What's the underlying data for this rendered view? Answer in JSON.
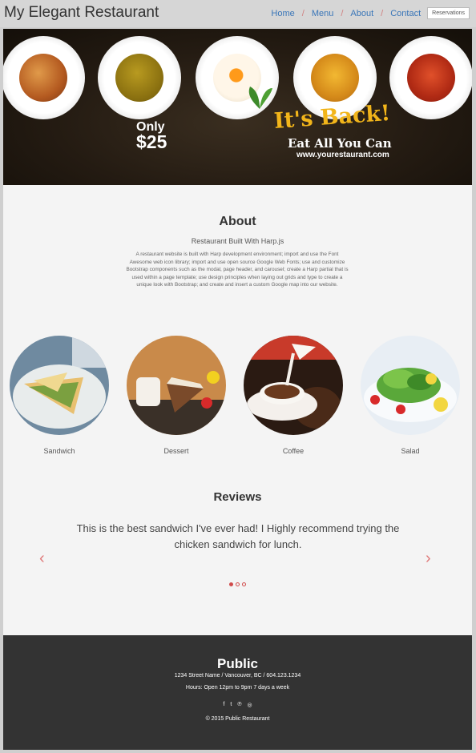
{
  "navbar": {
    "brand": "My Elegant Restaurant",
    "links": [
      {
        "label": "Home"
      },
      {
        "label": "Menu"
      },
      {
        "label": "About"
      },
      {
        "label": "Contact"
      }
    ],
    "separator": "/",
    "reservations_label": "Reservations"
  },
  "hero": {
    "only_label": "Only",
    "price": "$25",
    "headline": "It's Back!",
    "tagline": "Eat All You Can",
    "url": "www.yourestaurant.com"
  },
  "about": {
    "title": "About",
    "subtitle": "Restaurant Built With Harp.js",
    "body": "A restaurant website is built with Harp development environment; import and use the Font Awesome web icon library; import and use open source Google Web Fonts; use and customize Bootstrap components such as the modal, page header, and carousel; create a Harp partial that is used within a page template; use design principles when laying out grids and type to create a unique look with Bootstrap; and create and insert a custom Google map into our website."
  },
  "menu_items": [
    {
      "label": "Sandwich"
    },
    {
      "label": "Dessert"
    },
    {
      "label": "Coffee"
    },
    {
      "label": "Salad"
    }
  ],
  "reviews": {
    "title": "Reviews",
    "text": "This is the best sandwich I've ever had! I Highly recommend trying the chicken sandwich for lunch.",
    "prev_glyph": "‹",
    "next_glyph": "›"
  },
  "footer": {
    "name": "Public",
    "address": "1234 Street Name / Vancouver, BC / 604.123.1234",
    "hours": "Hours: Open 12pm to 9pm 7 days a week",
    "social": [
      {
        "icon": "facebook-icon",
        "glyph": "f"
      },
      {
        "icon": "twitter-icon",
        "glyph": "t"
      },
      {
        "icon": "pinterest-icon",
        "glyph": "℗"
      },
      {
        "icon": "instagram-icon",
        "glyph": "◎"
      }
    ],
    "copyright": "© 2015 Public Restaurant"
  },
  "colors": {
    "link": "#3a76b8",
    "accent": "#d04a4a",
    "headline": "#f2b51a",
    "footer_bg": "#333333"
  }
}
